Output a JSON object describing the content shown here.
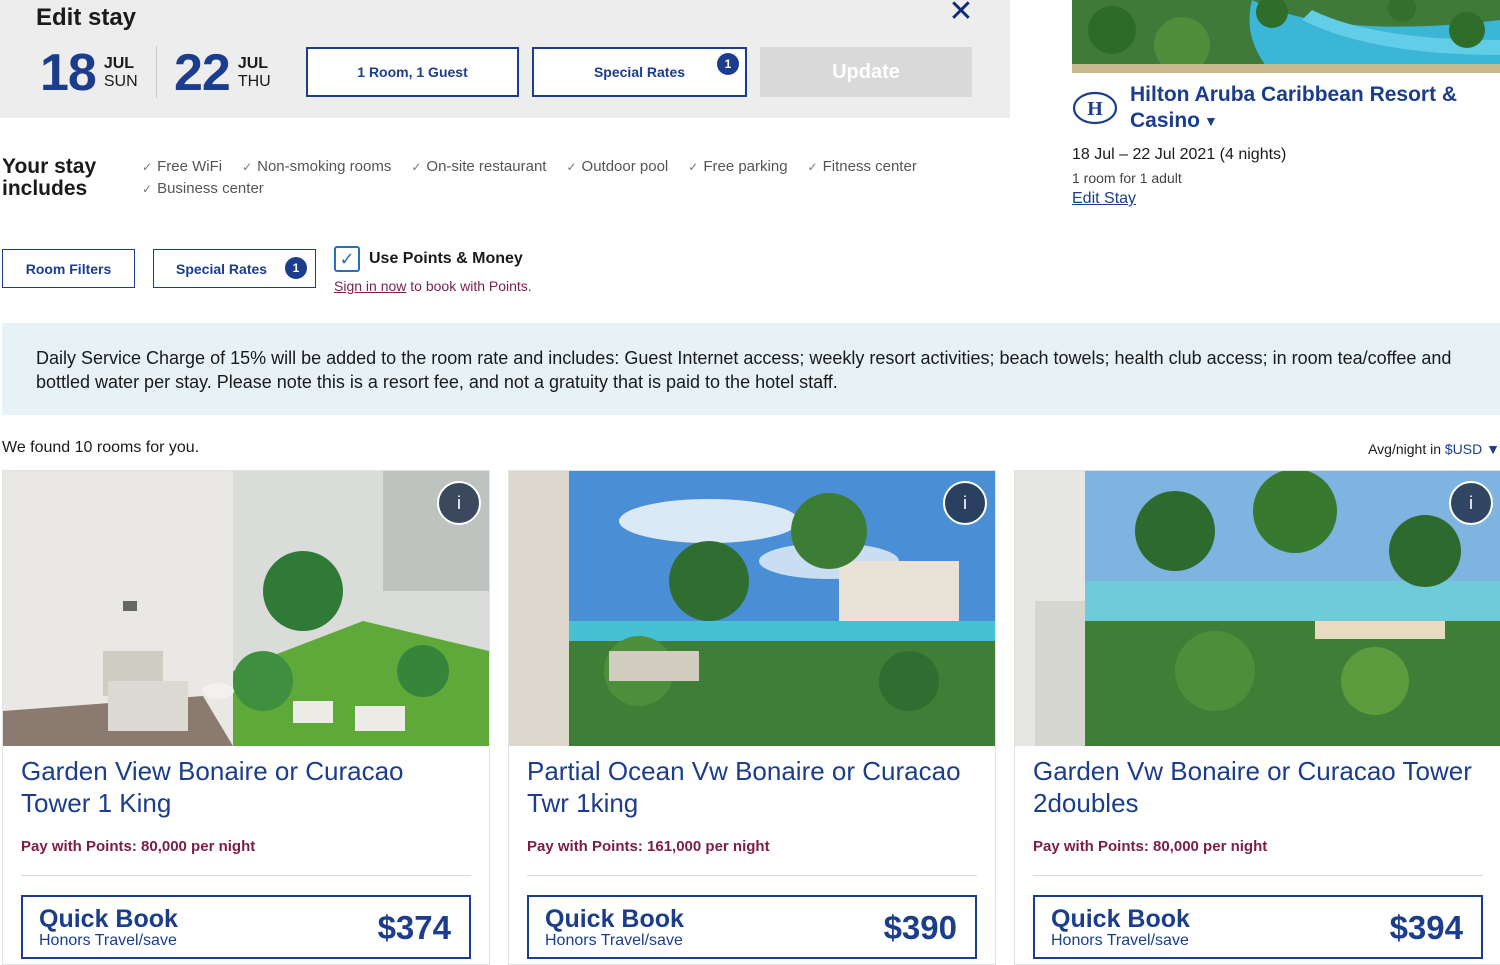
{
  "edit_stay": {
    "title": "Edit stay",
    "close_icon": "close-icon",
    "checkin": {
      "day": "18",
      "month": "JUL",
      "dow": "SUN"
    },
    "checkout": {
      "day": "22",
      "month": "JUL",
      "dow": "THU"
    },
    "rooms_guests": "1 Room, 1 Guest",
    "special_rates": "Special Rates",
    "special_rates_count": "1",
    "update": "Update"
  },
  "hotel": {
    "name": "Hilton Aruba Caribbean Resort & Casino",
    "caret": "▼",
    "logo_letter": "H",
    "dates": "18 Jul – 22 Jul 2021 (4 nights)",
    "guests": "1 room for 1 adult",
    "edit_link": "Edit Stay"
  },
  "includes": {
    "title": "Your stay includes",
    "items": [
      "Free WiFi",
      "Non-smoking rooms",
      "On-site restaurant",
      "Outdoor pool",
      "Free parking",
      "Fitness center",
      "Business center"
    ]
  },
  "filters": {
    "room_filters": "Room Filters",
    "special_rates": "Special Rates",
    "special_rates_count": "1",
    "use_points_label": "Use Points & Money",
    "use_points_checked": true,
    "signin_link": "Sign in now",
    "signin_rest": " to book with Points."
  },
  "notice": "Daily Service Charge of 15% will be added to the room rate and includes: Guest Internet access; weekly resort activities; beach towels; health club access; in room tea/coffee and bottled water per stay. Please note this is a resort fee, and not a gratuity that is paid to the hotel staff.",
  "results": {
    "found": "We found 10 rooms for you.",
    "avg_label": "Avg/night in ",
    "currency": "$USD",
    "currency_caret": "▼"
  },
  "rooms": [
    {
      "name": "Garden View Bonaire or Curacao Tower 1 King",
      "points": "Pay with Points: 80,000 per night",
      "qb_title": "Quick Book",
      "qb_sub": "Honors Travel/save",
      "price": "$374",
      "info": "i"
    },
    {
      "name": "Partial Ocean Vw Bonaire or Curacao Twr 1king",
      "points": "Pay with Points: 161,000 per night",
      "qb_title": "Quick Book",
      "qb_sub": "Honors Travel/save",
      "price": "$390",
      "info": "i"
    },
    {
      "name": "Garden Vw Bonaire or Curacao Tower 2doubles",
      "points": "Pay with Points: 80,000 per night",
      "qb_title": "Quick Book",
      "qb_sub": "Honors Travel/save",
      "price": "$394",
      "info": "i"
    }
  ],
  "colors": {
    "brand": "#1b3d8c",
    "points": "#7a1e48",
    "notice_bg": "#e6f2f5"
  }
}
